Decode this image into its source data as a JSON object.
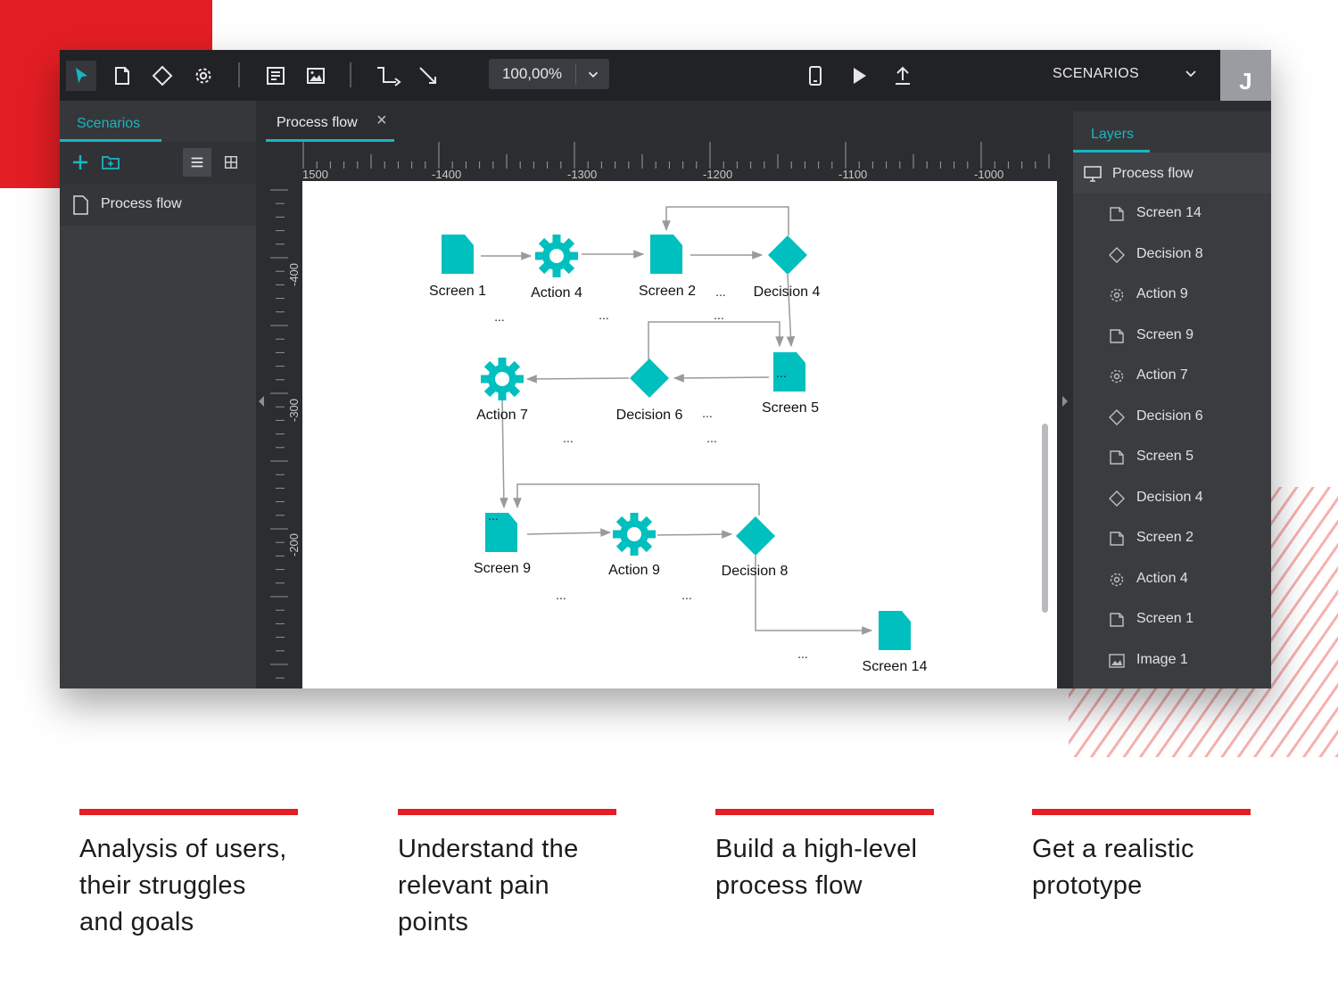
{
  "colors": {
    "brand_red": "#e31e24",
    "accent_teal": "#19b6c2",
    "shape_teal": "#00bfbf"
  },
  "toolbar": {
    "zoom": "100,00%",
    "scenarios_label": "SCENARIOS",
    "avatar_initial": "J",
    "icons": [
      "pointer-icon",
      "screen-icon",
      "diamond-icon",
      "gear-icon",
      "document-icon",
      "image-icon",
      "elbow-connector-icon",
      "arrow-connector-icon",
      "chevron-down-icon",
      "mobile-icon",
      "play-icon",
      "upload-icon"
    ]
  },
  "left_panel": {
    "tab": "Scenarios",
    "items": [
      {
        "label": "Process flow"
      }
    ]
  },
  "center": {
    "tab": {
      "label": "Process flow",
      "close": "×"
    },
    "ruler_top": [
      "1500",
      "-1400",
      "-1300",
      "-1200",
      "-1100",
      "-1000"
    ],
    "ruler_left": [
      "-400",
      "-300",
      "-200"
    ]
  },
  "diagram": {
    "nodes": [
      {
        "id": "screen1",
        "kind": "screen",
        "label": "Screen 1"
      },
      {
        "id": "action4",
        "kind": "action",
        "label": "Action 4"
      },
      {
        "id": "screen2",
        "kind": "screen",
        "label": "Screen 2"
      },
      {
        "id": "decision4",
        "kind": "decision",
        "label": "Decision 4"
      },
      {
        "id": "screen5",
        "kind": "screen",
        "label": "Screen 5"
      },
      {
        "id": "decision6",
        "kind": "decision",
        "label": "Decision 6"
      },
      {
        "id": "action7",
        "kind": "action",
        "label": "Action 7"
      },
      {
        "id": "screen9",
        "kind": "screen",
        "label": "Screen 9"
      },
      {
        "id": "action9",
        "kind": "action",
        "label": "Action 9"
      },
      {
        "id": "decision8",
        "kind": "decision",
        "label": "Decision 8"
      },
      {
        "id": "screen14",
        "kind": "screen",
        "label": "Screen 14"
      }
    ],
    "ellipsis": "..."
  },
  "right_panel": {
    "tab": "Layers",
    "root": "Process flow",
    "layers": [
      {
        "label": "Screen 14",
        "icon": "screen-icon"
      },
      {
        "label": "Decision 8",
        "icon": "diamond-icon"
      },
      {
        "label": "Action 9",
        "icon": "gear-icon"
      },
      {
        "label": "Screen 9",
        "icon": "screen-icon"
      },
      {
        "label": "Action 7",
        "icon": "gear-icon"
      },
      {
        "label": "Decision 6",
        "icon": "diamond-icon"
      },
      {
        "label": "Screen 5",
        "icon": "screen-icon"
      },
      {
        "label": "Decision 4",
        "icon": "diamond-icon"
      },
      {
        "label": "Screen 2",
        "icon": "screen-icon"
      },
      {
        "label": "Action 4",
        "icon": "gear-icon"
      },
      {
        "label": "Screen 1",
        "icon": "screen-icon"
      },
      {
        "label": "Image 1",
        "icon": "image-icon"
      }
    ]
  },
  "features": [
    {
      "line1": "Analysis of users,",
      "line2": "their struggles",
      "line3": "and goals"
    },
    {
      "line1": "Understand the",
      "line2": "relevant pain",
      "line3": "points"
    },
    {
      "line1": "Build a high-level",
      "line2": "process flow",
      "line3": ""
    },
    {
      "line1": "Get a realistic",
      "line2": "prototype",
      "line3": ""
    }
  ]
}
